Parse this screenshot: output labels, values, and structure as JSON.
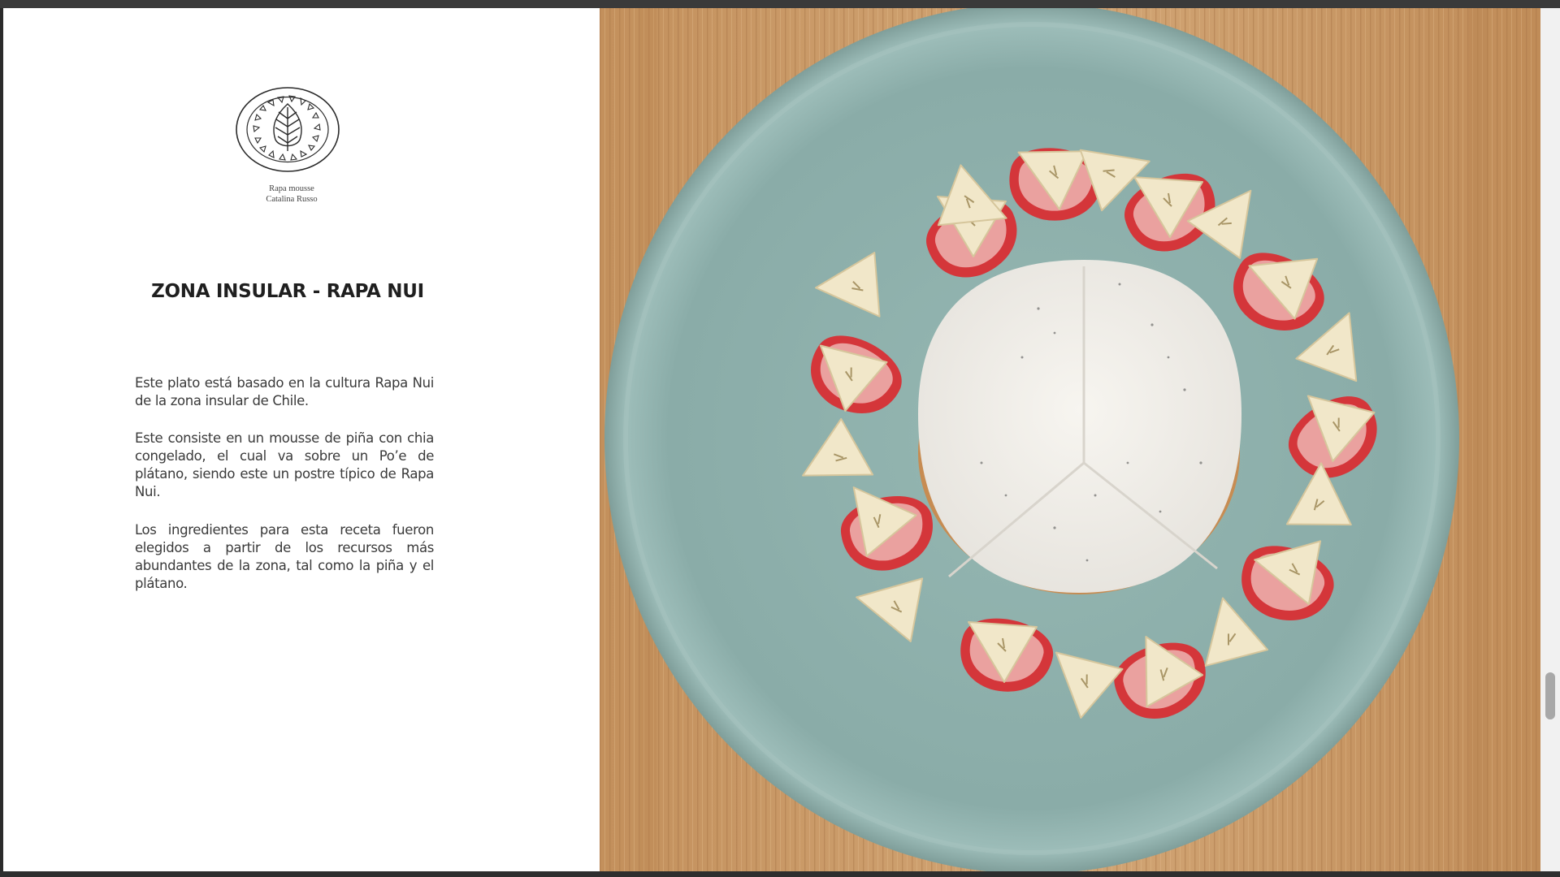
{
  "caption": {
    "line1": "Rapa mousse",
    "line2": "Catalina Russo"
  },
  "title": "ZONA INSULAR - RAPA NUI",
  "paragraphs": [
    "Este plato está basado en la cultura Rapa Nui de la zona insular de Chile.",
    "Este consiste en un mousse de piña con chia congelado, el cual va sobre un Po’e de plátano, siendo este un postre típico de Rapa Nui.",
    "Los ingredientes para esta receta fueron elegidos a partir de los recursos más abundantes de la zona, tal como la piña y el plátano."
  ],
  "logo_icon": "leaf-emblem-icon",
  "colors": {
    "plate": "#8fb1ad",
    "board": "#c89868",
    "strawberry": "#d93a3a",
    "banana": "#efe4c4",
    "mousse": "#f3f0ea"
  }
}
